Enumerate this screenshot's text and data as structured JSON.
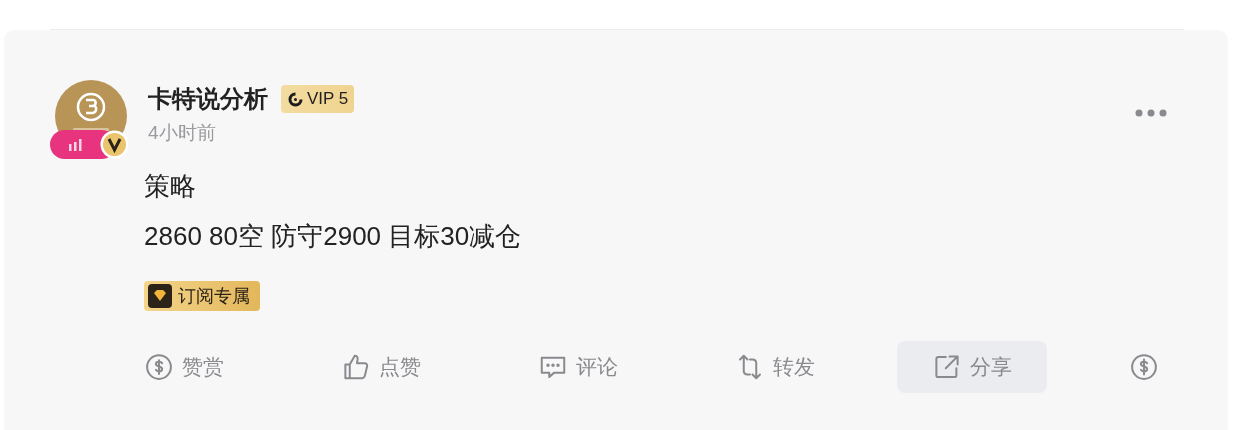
{
  "post": {
    "author": "卡特说分析",
    "vip": "VIP 5",
    "time": "4小时前",
    "title": "策略",
    "body": "2860 80空 防守2900 目标30减仓",
    "tag": "订阅专属"
  },
  "actions": [
    {
      "kind": "reward",
      "label": "赞赏",
      "highlighted": false
    },
    {
      "kind": "like",
      "label": "点赞",
      "highlighted": false
    },
    {
      "kind": "comment",
      "label": "评论",
      "highlighted": false
    },
    {
      "kind": "repost",
      "label": "转发",
      "highlighted": false
    },
    {
      "kind": "share",
      "label": "分享",
      "highlighted": true
    },
    {
      "kind": "tip",
      "highlighted": false
    }
  ]
}
